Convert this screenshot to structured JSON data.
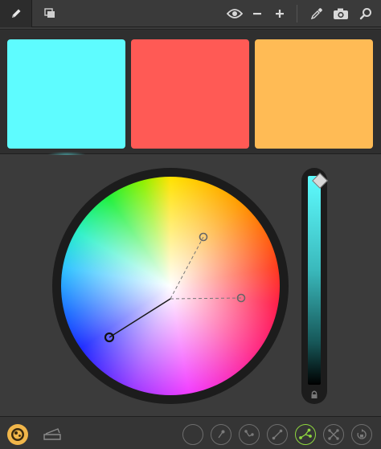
{
  "toolbar": {
    "tabs": [
      {
        "icon": "pencil-icon",
        "active": true
      },
      {
        "icon": "layers-icon",
        "active": false
      }
    ],
    "tools": [
      "eye-icon",
      "minus-icon",
      "plus-icon",
      "eyedropper-icon",
      "camera-icon",
      "search-icon"
    ]
  },
  "swatches": [
    {
      "color": "#5efcff",
      "selected": true
    },
    {
      "color": "#ff5a55",
      "selected": false
    },
    {
      "color": "#ffbb55",
      "selected": false
    }
  ],
  "brightness": {
    "level": 0.99
  },
  "bottombar": {
    "left_icons": [
      "color-wheel-icon",
      "library-icon"
    ],
    "harmony_rules": [
      {
        "icon": "rule-custom-icon",
        "selected": false
      },
      {
        "icon": "rule-analogous-icon",
        "selected": false
      },
      {
        "icon": "rule-monochromatic-icon",
        "selected": false
      },
      {
        "icon": "rule-complementary-icon",
        "selected": false
      },
      {
        "icon": "rule-triad-icon",
        "selected": true
      },
      {
        "icon": "rule-compound-icon",
        "selected": false
      },
      {
        "icon": "rule-shades-icon",
        "selected": false
      }
    ]
  }
}
